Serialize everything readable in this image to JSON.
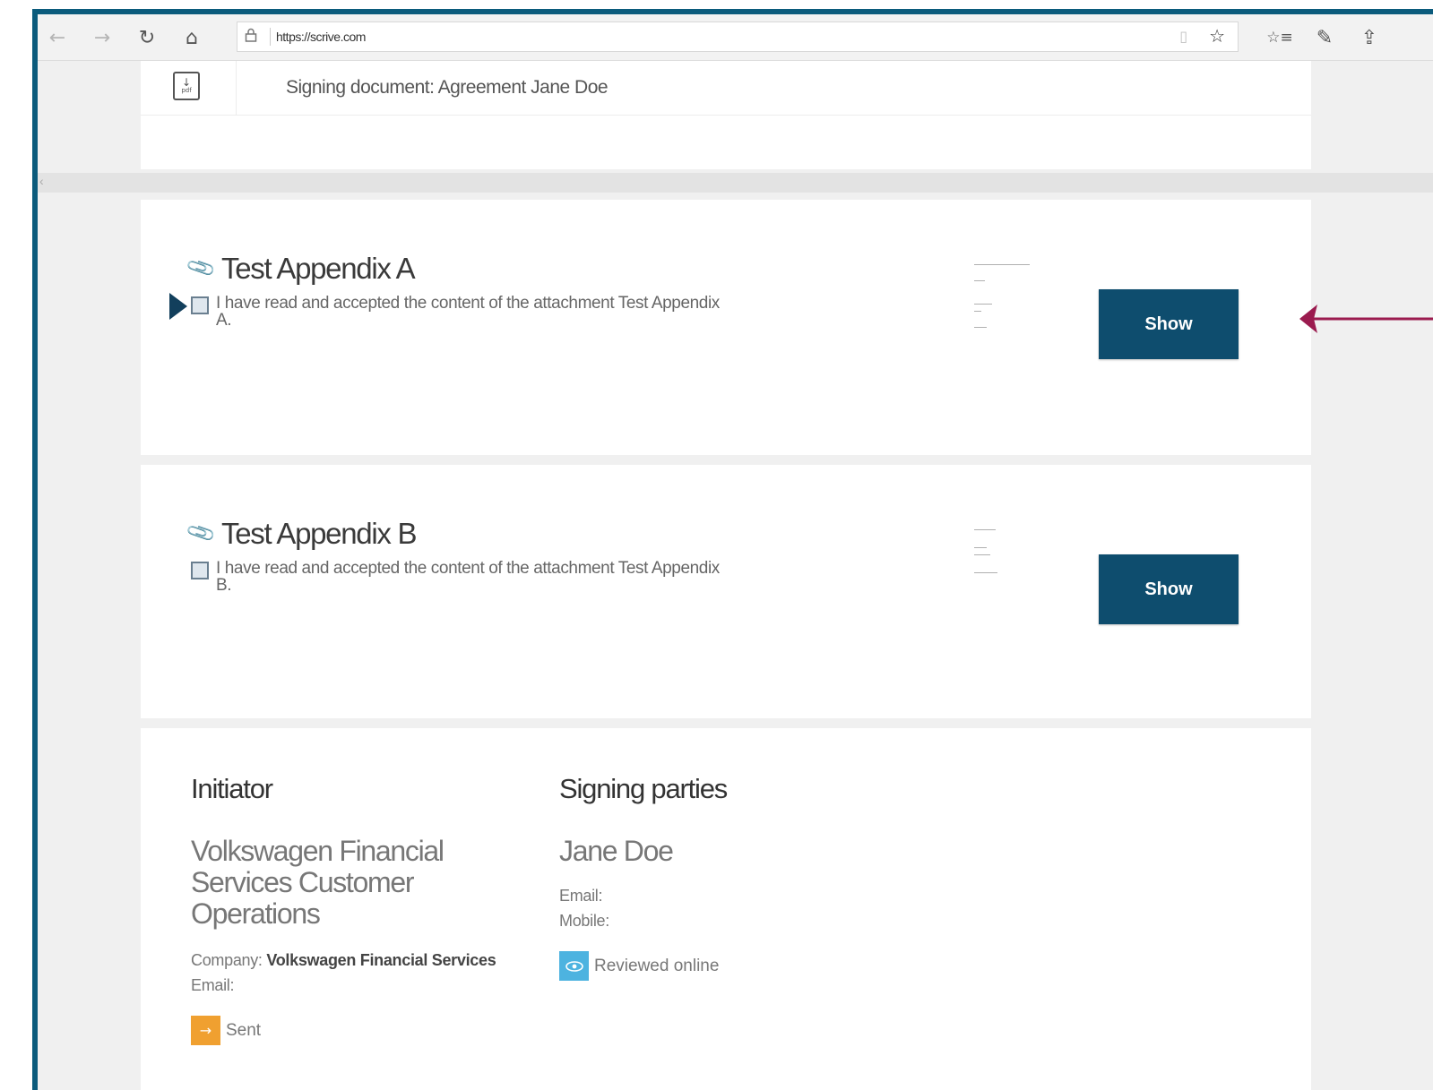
{
  "browser": {
    "back": "←",
    "forward": "→",
    "refresh": "↻",
    "home": "⌂",
    "lock": "🔒",
    "url": "https://scrive.com",
    "reading_view": "▯",
    "favorite": "☆",
    "favorites_list": "☆≡",
    "notes": "✎",
    "share": "⇪"
  },
  "header": {
    "title": "Signing document: Agreement Jane Doe",
    "pdf_arrow": "↓",
    "pdf_label": "pdf"
  },
  "attachments": [
    {
      "title": "Test Appendix A",
      "accept_text": "I have read and accepted the content of the attachment Test Appendix A.",
      "show_label": "Show"
    },
    {
      "title": "Test Appendix B",
      "accept_text": "I have read and accepted the content of the attachment Test Appendix B.",
      "show_label": "Show"
    }
  ],
  "initiator": {
    "heading": "Initiator",
    "name": "Volkswagen Financial Services Customer Operations",
    "company_label": "Company:",
    "company_value": "Volkswagen Financial Services",
    "email_label": "Email:",
    "status": "Sent",
    "status_icon": "→"
  },
  "signing_parties": {
    "heading": "Signing parties",
    "name": "Jane Doe",
    "email_label": "Email:",
    "mobile_label": "Mobile:",
    "status": "Reviewed online",
    "status_icon": "👁"
  },
  "colors": {
    "frame_border": "#0b5b7c",
    "show_button": "#0e4d6e",
    "annotation_arrow": "#9b1b4f",
    "sent_badge": "#f0a030",
    "reviewed_badge": "#4db3e0"
  }
}
